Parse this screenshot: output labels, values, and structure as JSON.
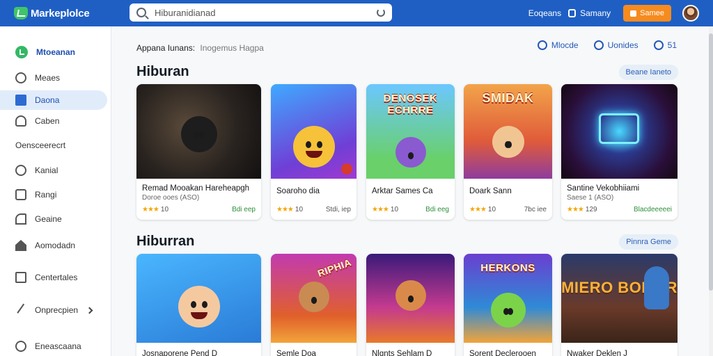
{
  "app": {
    "name": "Markeplolce"
  },
  "search": {
    "placeholder": "Hiburanidianad"
  },
  "header": {
    "links": [
      "Eoqeans",
      "Samany"
    ],
    "cta_label": "Samee"
  },
  "sidebar": {
    "top_label": "Mtoeanan",
    "section_label": "Oensceerecrt",
    "items": [
      "Meaes",
      "Daona",
      "Caben",
      "Kanial",
      "Rangi",
      "Geaine",
      "Aomodadn",
      "Centertales",
      "Onprecpien",
      "Eneascaana"
    ]
  },
  "main": {
    "breadcrumb": "Appana Iunans:",
    "breadcrumb_sub": "Inogemus Hagpa",
    "actions": [
      "Mlocde",
      "Uonides",
      "51"
    ],
    "sections": [
      {
        "title": "Hiburan",
        "pill": "Beane Ianeto"
      },
      {
        "title": "Hiburran",
        "pill": "Pinnra Geme"
      }
    ],
    "row1": [
      {
        "title": "Remad Mooakan Hareheapgh",
        "sub": "Doroe ooes (ASO)",
        "rating": "10",
        "price": "Bdi eep"
      },
      {
        "title": "Soaroho dia",
        "sub": "",
        "rating": "10",
        "price": "Stdi, iep"
      },
      {
        "title": "Arktar Sames Ca",
        "sub": "",
        "rating": "10",
        "price": "Bdi eeg"
      },
      {
        "title": "Doark Sann",
        "sub": "",
        "rating": "10",
        "price": "7bc iee"
      },
      {
        "title": "Santine Vekobhiiami",
        "sub": "Saese 1 (ASO)",
        "rating": "129",
        "price": "Blacdeeeeei"
      }
    ],
    "row2": [
      {
        "title": "Josnaporene Pend D",
        "word": ""
      },
      {
        "title": "Semle Doa",
        "word": "RIPHIA"
      },
      {
        "title": "Nlgnts Sehlam D",
        "word": ""
      },
      {
        "title": "Sorent Declerooen",
        "word": "HERKONS"
      },
      {
        "title": "Nwaker Deklen J",
        "word": "MIERO BOMAR"
      }
    ],
    "row1_words": [
      "",
      "",
      "DENOSEK ECHRRE",
      "SMIDAK",
      ""
    ]
  },
  "colors": {
    "accent": "#1f5fc4",
    "cta": "#f68b1e",
    "brand_green": "#3fc46a",
    "rating": "#f2a600",
    "price": "#2f8f3c"
  }
}
